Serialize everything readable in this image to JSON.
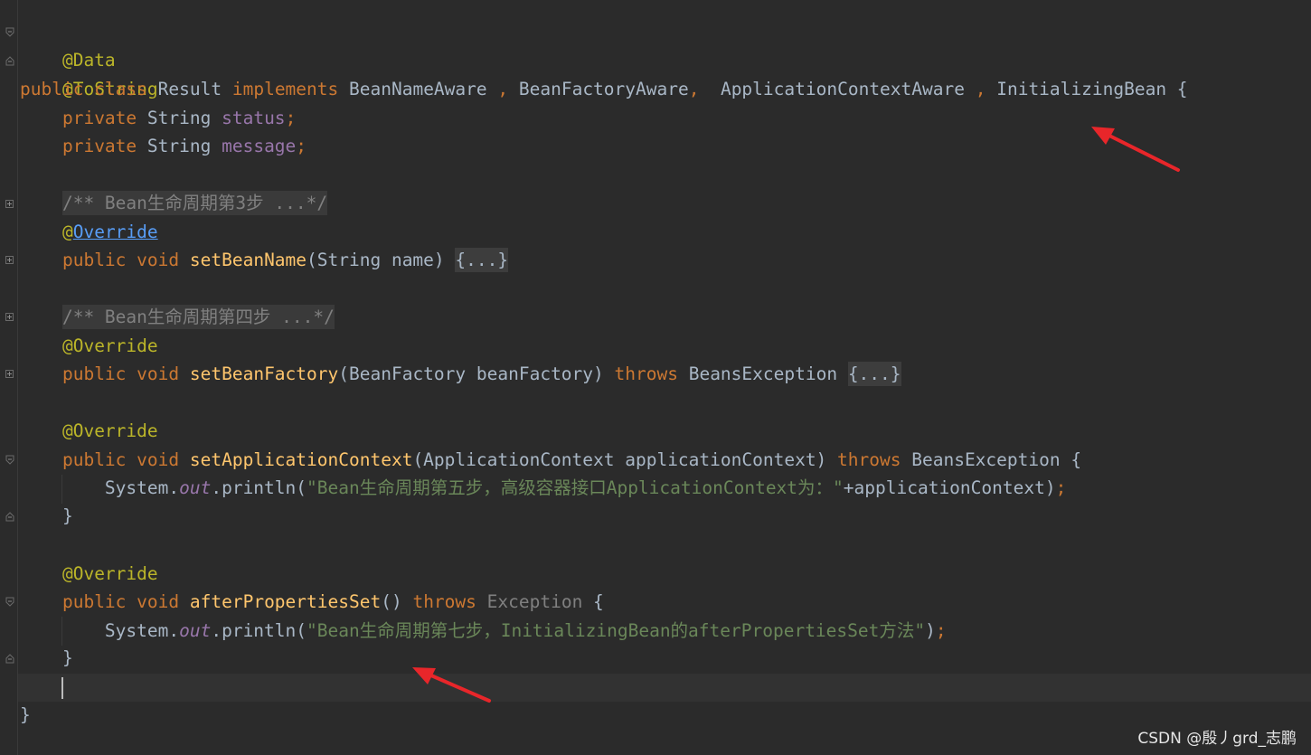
{
  "editor": {
    "lines": {
      "l1": {
        "annotation": "@Data"
      },
      "l2": {
        "annotation": "@ToString"
      },
      "l3": {
        "kw_public": "public",
        "kw_class": "class",
        "class_name": "Result",
        "kw_implements": "implements",
        "iface1": "BeanNameAware",
        "sep1": " , ",
        "iface2": "BeanFactoryAware",
        "sep2": ",  ",
        "iface3": "ApplicationContextAware",
        "sep3": " , ",
        "iface4": "InitializingBean",
        "brace": " {"
      },
      "l4": {
        "kw": "private",
        "type": "String",
        "name": "status",
        "semi": ";"
      },
      "l5": {
        "kw": "private",
        "type": "String",
        "name": "message",
        "semi": ";"
      },
      "l7": {
        "comment": "/** Bean生命周期第3步 ...*/"
      },
      "l8": {
        "at": "@",
        "annotation": "Override"
      },
      "l9": {
        "kw_public": "public",
        "kw_void": "void",
        "method": "setBeanName",
        "params": "(String name) ",
        "folded": "{...}"
      },
      "l11": {
        "comment": "/** Bean生命周期第四步 ...*/"
      },
      "l12": {
        "annotation": "@Override"
      },
      "l13": {
        "kw_public": "public",
        "kw_void": "void",
        "method": "setBeanFactory",
        "params": "(BeanFactory beanFactory) ",
        "kw_throws": "throws",
        "exception": " BeansException ",
        "folded": "{...}"
      },
      "l15": {
        "annotation": "@Override"
      },
      "l16": {
        "kw_public": "public",
        "kw_void": "void",
        "method": "setApplicationContext",
        "params": "(ApplicationContext applicationContext) ",
        "kw_throws": "throws",
        "exception": " BeansException {"
      },
      "l17": {
        "system": "System.",
        "out": "out",
        "println": ".println(",
        "string": "\"Bean生命周期第五步，高级容器接口ApplicationContext为：\"",
        "rest": "+applicationContext)",
        "semi": ";"
      },
      "l18": {
        "brace": "}"
      },
      "l20": {
        "annotation": "@Override"
      },
      "l21": {
        "kw_public": "public",
        "kw_void": "void",
        "method": "afterPropertiesSet",
        "params": "() ",
        "kw_throws": "throws",
        "exception": " Exception",
        "brace": " {"
      },
      "l22": {
        "system": "System.",
        "out": "out",
        "println": ".println(",
        "string": "\"Bean生命周期第七步，InitializingBean的afterPropertiesSet方法\"",
        "rest": ")",
        "semi": ";"
      },
      "l23": {
        "brace": "}"
      },
      "l25": {
        "brace": "}"
      }
    }
  },
  "watermark": "CSDN @殷丿grd_志鹏",
  "colors": {
    "background": "#2b2b2b",
    "keyword": "#cc7832",
    "annotation": "#bbb529",
    "method": "#ffc66d",
    "field": "#9876aa",
    "string": "#6a8759",
    "arrow": "#e8262a"
  },
  "icons": [
    "fold-icon",
    "arrow-icon"
  ]
}
